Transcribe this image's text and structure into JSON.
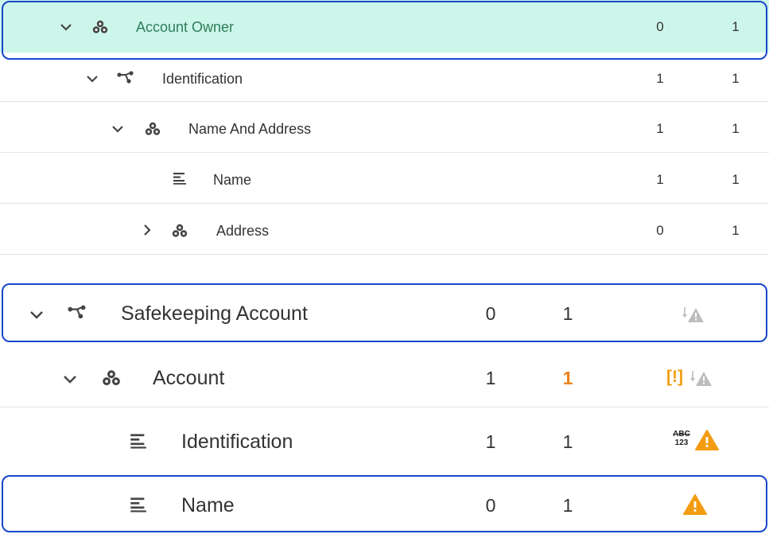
{
  "tree_top": [
    {
      "label": "Account Owner",
      "min": "0",
      "max": "1",
      "chevron": "chevron-down-icon",
      "icon": "group-icon"
    },
    {
      "label": "Identification",
      "min": "1",
      "max": "1",
      "chevron": "chevron-down-icon",
      "icon": "choice-icon"
    },
    {
      "label": "Name And Address",
      "min": "1",
      "max": "1",
      "chevron": "chevron-down-icon",
      "icon": "group-icon"
    },
    {
      "label": "Name",
      "min": "1",
      "max": "1",
      "chevron": "",
      "icon": "text-field-icon"
    },
    {
      "label": "Address",
      "min": "0",
      "max": "1",
      "chevron": "chevron-right-icon",
      "icon": "group-icon"
    }
  ],
  "tree_bottom": [
    {
      "label": "Safekeeping Account",
      "min": "0",
      "max": "1",
      "chevron": "chevron-down-icon",
      "icon": "choice-icon",
      "status": [
        "rule-warning-icon"
      ]
    },
    {
      "label": "Account",
      "min": "1",
      "max": "1",
      "max_color": "#e8831a",
      "chevron": "chevron-down-icon",
      "icon": "group-icon",
      "status": [
        "cardinality-warning-icon",
        "rule-warning-icon"
      ]
    },
    {
      "label": "Identification",
      "min": "1",
      "max": "1",
      "chevron": "",
      "icon": "text-field-icon",
      "status": [
        "format-icon",
        "warning-icon"
      ],
      "format_text_top": "ABC",
      "format_text_bottom": "123"
    },
    {
      "label": "Name",
      "min": "0",
      "max": "1",
      "chevron": "",
      "icon": "text-field-icon",
      "status": [
        "warning-icon"
      ]
    }
  ],
  "colors": {
    "selected_bg": "#cdf6ea",
    "selected_text": "#2e7d5b",
    "highlight_border": "#1746c8",
    "warning_orange": "#f39c12",
    "warning_grey": "#bdbdbd"
  },
  "cardinality_warning_text": "[!]"
}
